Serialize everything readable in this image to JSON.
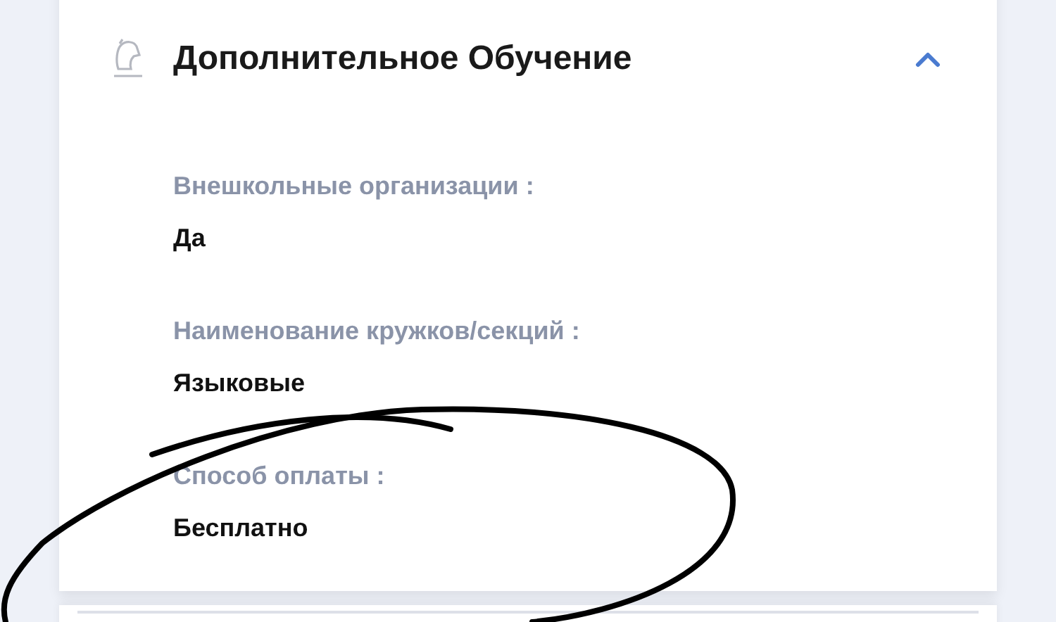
{
  "section": {
    "title": "Дополнительное Обучение",
    "expanded": true,
    "fields": [
      {
        "label": "Внешкольные организации :",
        "value": "Да"
      },
      {
        "label": "Наименование кружков/секций :",
        "value": "Языковые"
      },
      {
        "label": "Способ оплаты :",
        "value": "Бесплатно"
      }
    ]
  }
}
